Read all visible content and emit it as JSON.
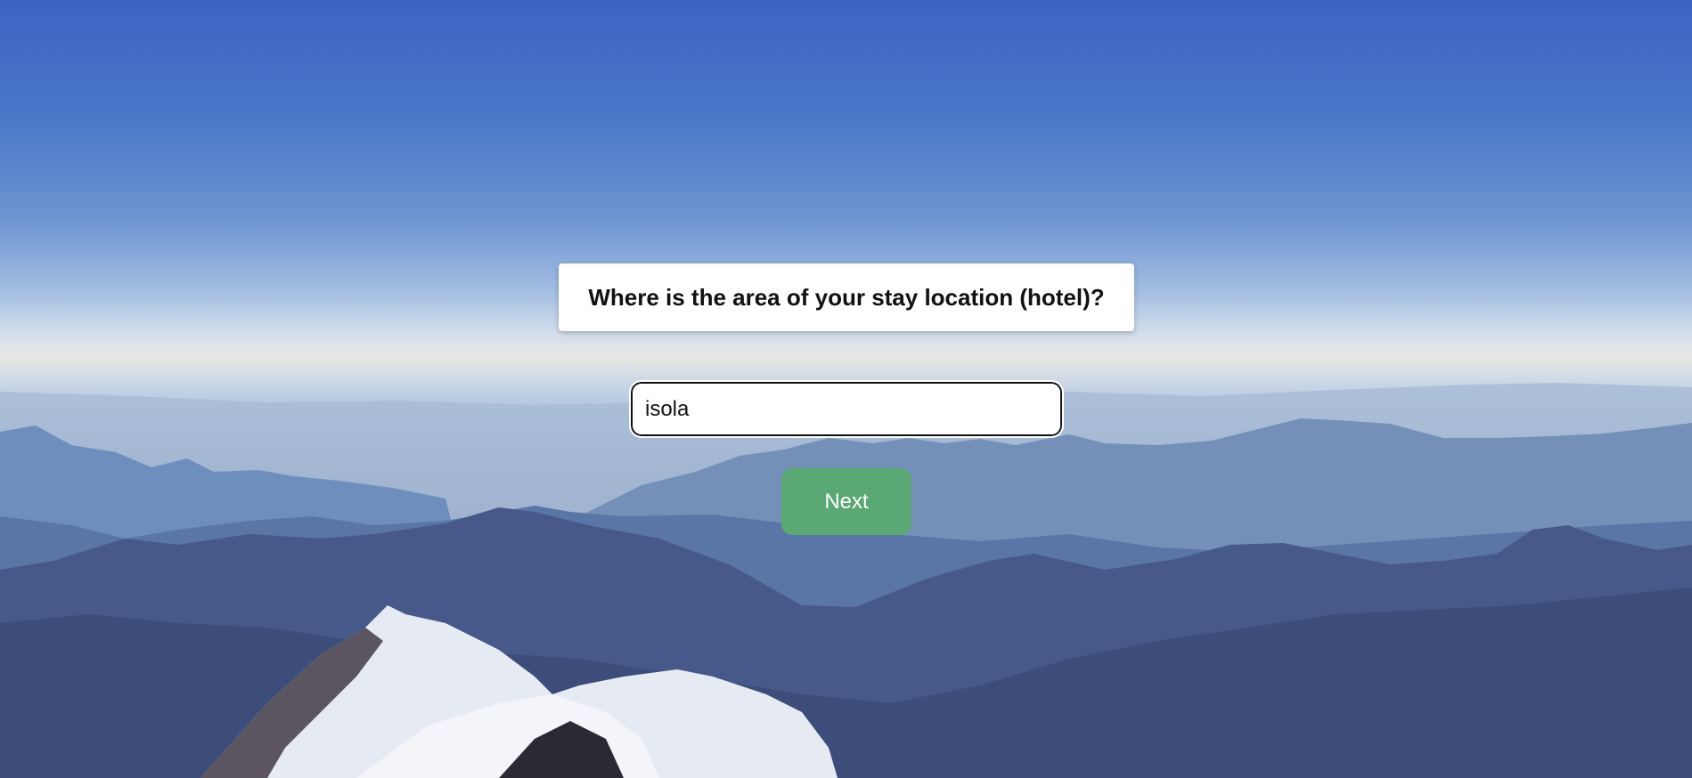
{
  "survey": {
    "question": "Where is the area of your stay location (hotel)?",
    "answer_value": "isola",
    "next_label": "Next"
  },
  "colors": {
    "sky_top": "#3d63c1",
    "horizon": "#e8e7e4",
    "mountain_dark": "#34466f",
    "next_button": "#5aa873"
  }
}
